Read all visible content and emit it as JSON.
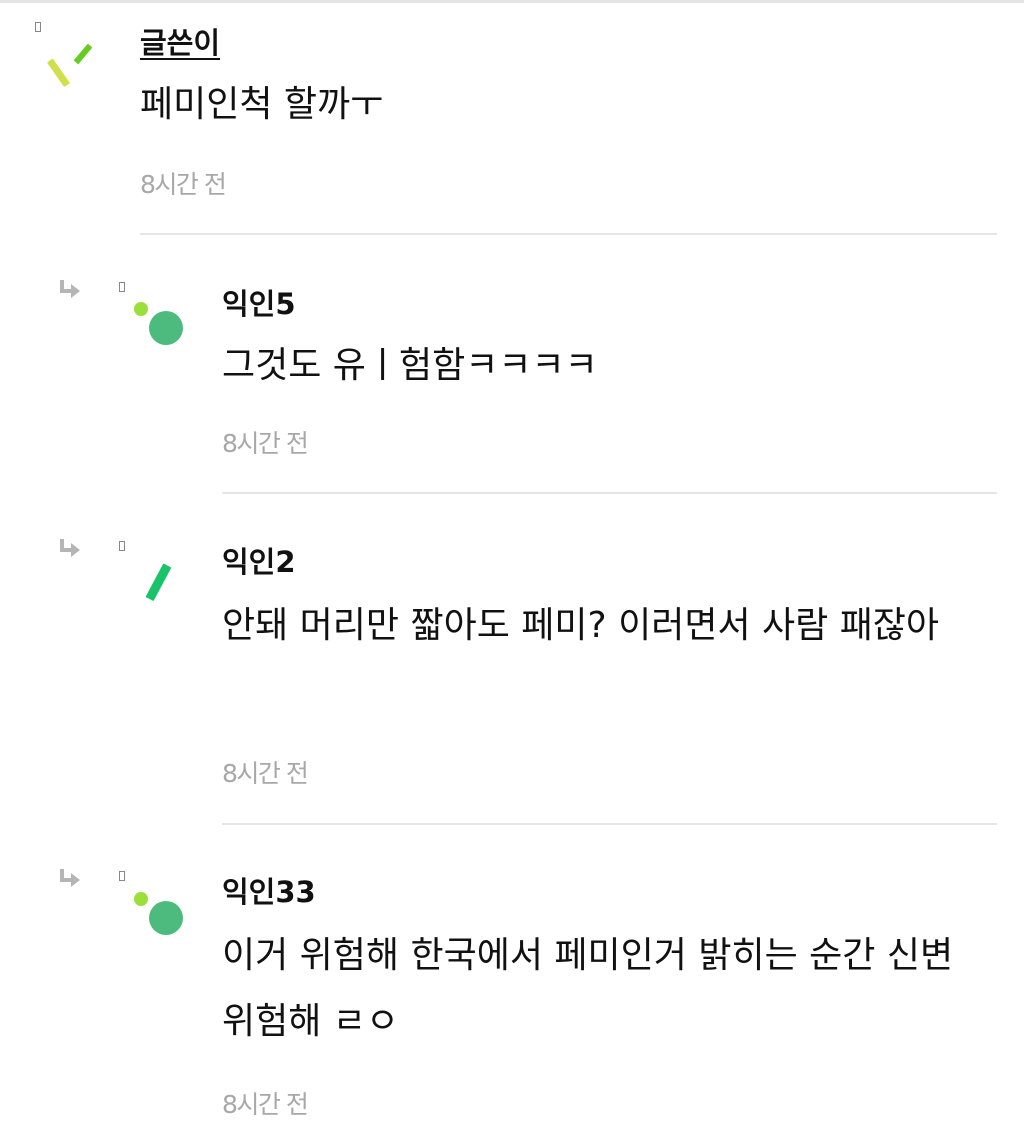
{
  "comments": [
    {
      "author": "글쓴이",
      "is_op": true,
      "is_reply": false,
      "avatar_icon": "avatar-sticks-icon",
      "body": "페미인척 할까ㅜ",
      "time": "8시간 전"
    },
    {
      "author": "익인5",
      "is_op": false,
      "is_reply": true,
      "avatar_icon": "avatar-dots-icon",
      "body": "그것도 유ㅣ험함ㅋㅋㅋㅋ",
      "time": "8시간 전"
    },
    {
      "author": "익인2",
      "is_op": false,
      "is_reply": true,
      "avatar_icon": "avatar-stick-icon",
      "body": "안돼 머리만 짧아도 페미? 이러면서 사람 패잖아",
      "time": "8시간 전"
    },
    {
      "author": "익인33",
      "is_op": false,
      "is_reply": true,
      "avatar_icon": "avatar-dots-icon",
      "body": "이거 위험해 한국에서 페미인거 밝히는 순간 신변 위험해 ㄹㅇ",
      "time": "8시간 전"
    }
  ],
  "colors": {
    "timestamp": "#a8a8a8",
    "divider": "#e6e6e6",
    "avatar_green": "#4dbb7d",
    "avatar_lime": "#9be03a",
    "avatar_olive": "#cfe04a",
    "avatar_stick": "#19c36a"
  }
}
